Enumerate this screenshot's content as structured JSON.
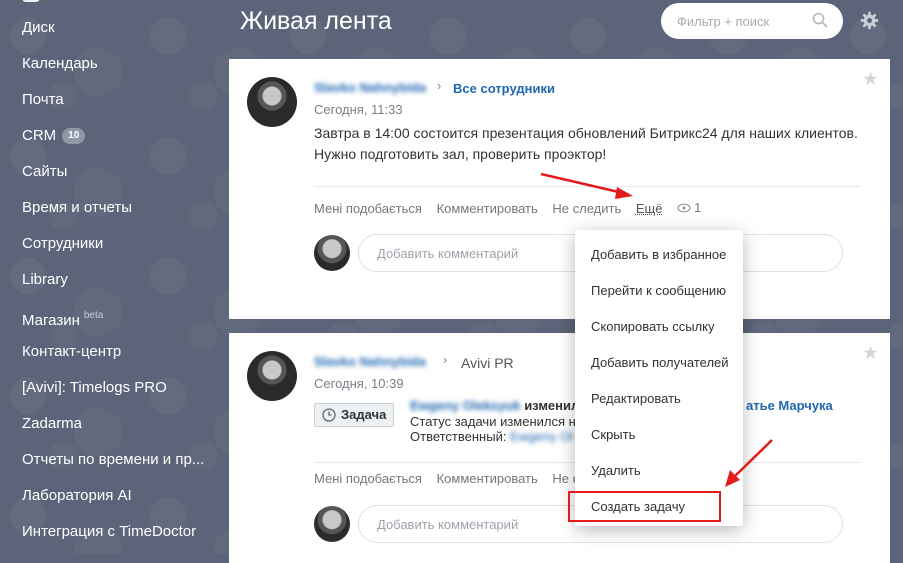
{
  "sidebar": {
    "items": [
      {
        "label": "Диск"
      },
      {
        "label": "Календарь"
      },
      {
        "label": "Почта"
      },
      {
        "label": "CRM",
        "badge": "10"
      },
      {
        "label": "Сайты"
      },
      {
        "label": "Время и отчеты"
      },
      {
        "label": "Сотрудники"
      },
      {
        "label": "Library"
      },
      {
        "label": "Магазин",
        "sup": "beta"
      },
      {
        "label": "Контакт-центр"
      },
      {
        "label": "[Avivi]: Timelogs PRO"
      },
      {
        "label": "Zadarma"
      },
      {
        "label": "Отчеты по времени и пр..."
      },
      {
        "label": "Лаборатория AI"
      },
      {
        "label": "Интеграция с TimeDoctor"
      }
    ]
  },
  "header": {
    "title": "Живая лента",
    "search_placeholder": "Фильтр + поиск",
    "icons": [
      "search-icon",
      "gear-icon"
    ]
  },
  "posts": [
    {
      "author": "Slavko Nahnybida",
      "destination": "Все сотрудники",
      "date": "Сегодня, 11:33",
      "text": "Завтра в 14:00 состоится презентация обновлений Битрикс24 для наших клиентов. Нужно подготовить зал, проверить проэктор!",
      "actions": {
        "like": "Мені подобається",
        "comment": "Комментировать",
        "unfollow": "Не следить",
        "more": "Ещё",
        "views": "1"
      },
      "comment_placeholder": "Добавить комментарий"
    },
    {
      "author": "Slavko Nahnybida",
      "destination": "Avivi PR",
      "date": "Сегодня, 10:39",
      "task_label": "Задача",
      "task_author": "Ewgeny Oleksyuk",
      "task_changed": "изменил",
      "task_title_tail": "атье Марчука",
      "task_status": "Статус задачи изменился н",
      "task_responsible_label": "Ответственный:",
      "task_responsible": "Ewgeny Ol",
      "actions": {
        "like": "Мені подобається",
        "comment": "Комментировать",
        "unfollow": "Не следить"
      },
      "comment_placeholder": "Добавить комментарий"
    }
  ],
  "menu": {
    "items": [
      {
        "label": "Добавить в избранное"
      },
      {
        "label": "Перейти к сообщению"
      },
      {
        "label": "Скопировать ссылку"
      },
      {
        "label": "Добавить получателей"
      },
      {
        "label": "Редактировать"
      },
      {
        "label": "Скрыть"
      },
      {
        "label": "Удалить"
      },
      {
        "label": "Создать задачу"
      }
    ],
    "highlighted": "Создать задачу"
  },
  "colors": {
    "annotation": "#e31b1b",
    "link": "#2067b0",
    "sidebar_bg": "#5b6478"
  }
}
